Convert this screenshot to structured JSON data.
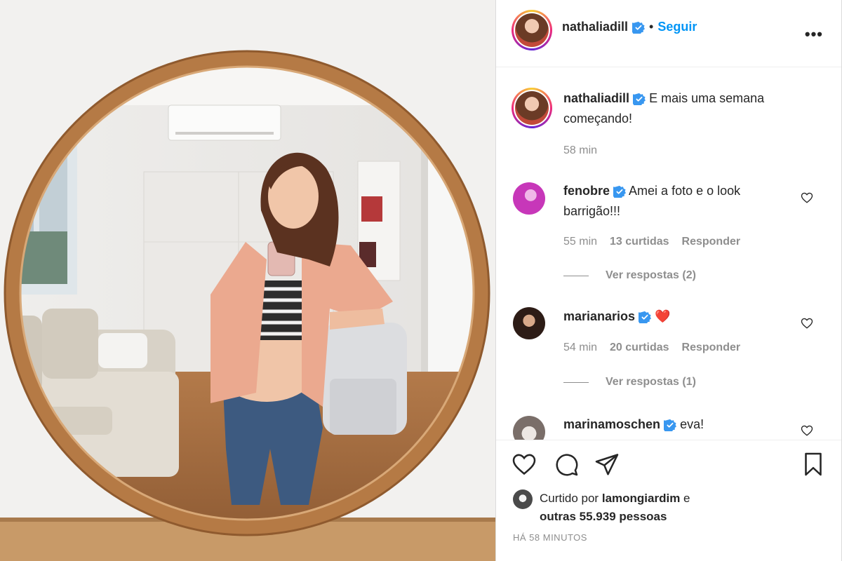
{
  "post": {
    "author": "nathaliadill",
    "follow_label": "Seguir",
    "separator": "•",
    "more_label": "•••"
  },
  "caption": {
    "username": "nathaliadill",
    "text": "E mais uma semana começando!",
    "time": "58 min"
  },
  "comments": [
    {
      "username": "fenobre",
      "verified": true,
      "text": "Amei a foto e o look barrigão!!!",
      "time": "55 min",
      "likes": "13 curtidas",
      "reply_label": "Responder",
      "view_replies": "Ver respostas (2)"
    },
    {
      "username": "marianarios",
      "verified": true,
      "text": "❤️",
      "time": "54 min",
      "likes": "20 curtidas",
      "reply_label": "Responder",
      "view_replies": "Ver respostas (1)"
    },
    {
      "username": "marinamoschen",
      "verified": true,
      "text": "eva!"
    }
  ],
  "actions": {
    "icons": [
      "heart-icon",
      "comment-icon",
      "share-icon",
      "bookmark-icon"
    ]
  },
  "likes": {
    "prefix": "Curtido por",
    "user": "lamongiardim",
    "conjunction": "e",
    "others": "outras 55.939 pessoas"
  },
  "timestamp": "HÁ 58 MINUTOS",
  "colors": {
    "accent": "#0095f6",
    "verified": "#3897f0",
    "text": "#262626",
    "muted": "#8e8e8e",
    "heart_red": "#ed4956"
  }
}
